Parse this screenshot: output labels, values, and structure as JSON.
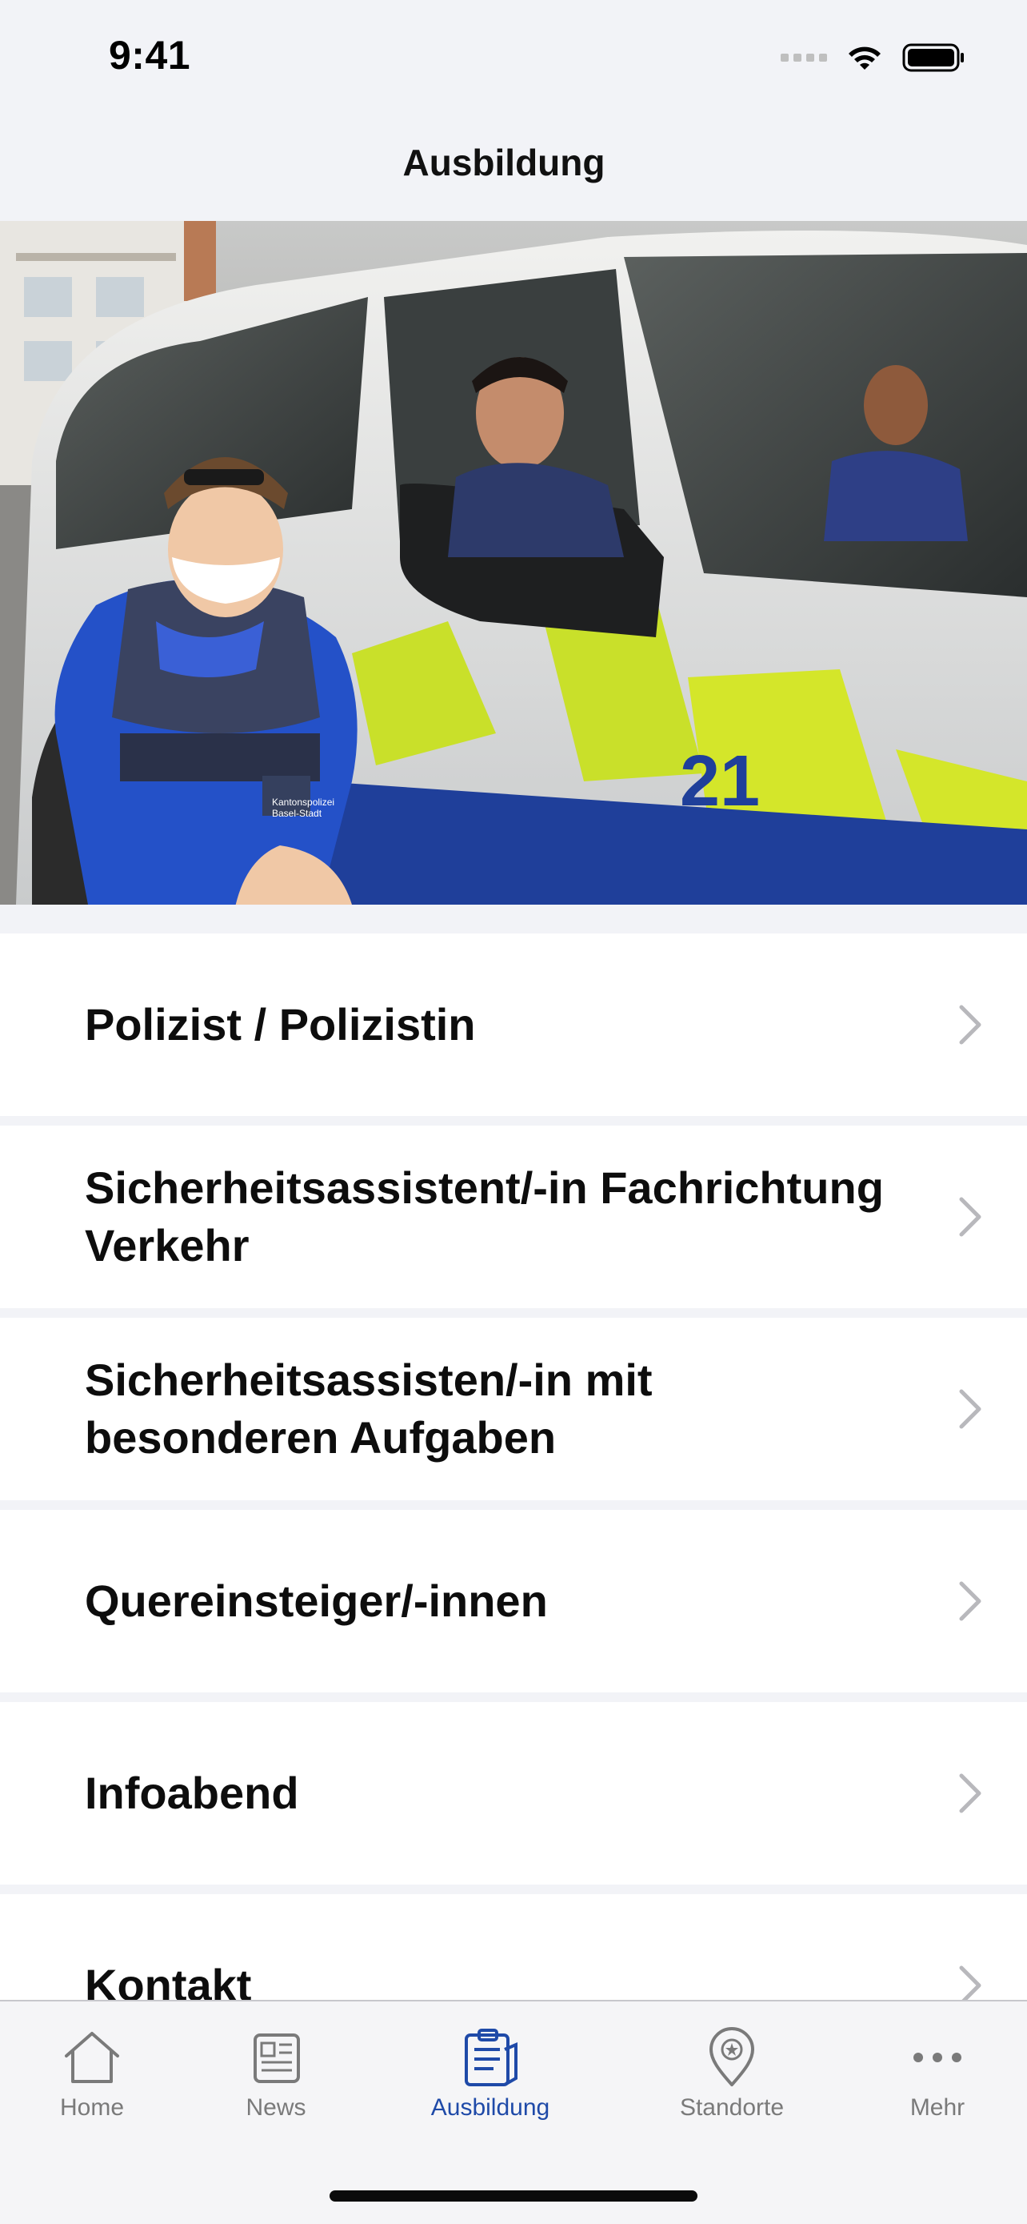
{
  "status_bar": {
    "time": "9:41"
  },
  "nav": {
    "title": "Ausbildung"
  },
  "hero": {
    "van_number": "21",
    "badge_line1": "Kantonspolizei",
    "badge_line2": "Basel-Stadt"
  },
  "list": {
    "items": [
      {
        "label": "Polizist / Polizistin"
      },
      {
        "label": "Sicherheitsassistent/-in Fachrichtung Verkehr"
      },
      {
        "label": "Sicherheitsassisten/-in mit besonderen Aufgaben"
      },
      {
        "label": "Quereinsteiger/-innen"
      },
      {
        "label": "Infoabend"
      },
      {
        "label": "Kontakt"
      }
    ]
  },
  "tabs": {
    "items": [
      {
        "label": "Home",
        "icon": "house-icon"
      },
      {
        "label": "News",
        "icon": "newspaper-icon"
      },
      {
        "label": "Ausbildung",
        "icon": "clipboard-icon",
        "active": true
      },
      {
        "label": "Standorte",
        "icon": "map-pin-icon"
      },
      {
        "label": "Mehr",
        "icon": "ellipsis-icon"
      }
    ]
  },
  "colors": {
    "accent": "#1f4aa8",
    "inactive": "#7a7a7a",
    "chevron": "#b8b8bc"
  }
}
